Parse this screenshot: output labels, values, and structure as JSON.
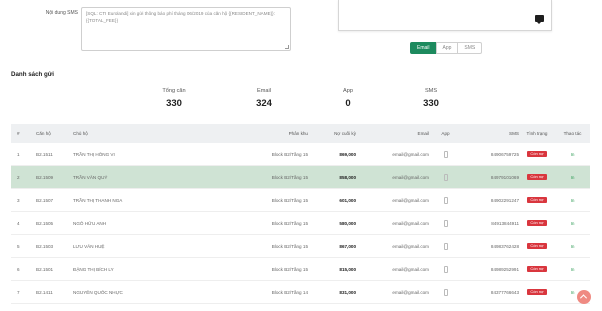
{
  "form": {
    "sms_label": "Nội dung SMS",
    "sms_content": "[SQL: CTI Eurolandi] xin gửi thông báo phí tháng 06/2019 của căn hộ {{RESIDENT_NAME}}: {{TOTAL_FEE}}"
  },
  "channels": [
    "Email",
    "App",
    "SMS"
  ],
  "active_channel": "Email",
  "section_title": "Danh sách gửi",
  "stats": [
    {
      "label": "Tổng căn",
      "value": "330"
    },
    {
      "label": "Email",
      "value": "324"
    },
    {
      "label": "App",
      "value": "0"
    },
    {
      "label": "SMS",
      "value": "330"
    }
  ],
  "table": {
    "headers": {
      "idx": "#",
      "unit": "Căn hộ",
      "owner": "Chủ hộ",
      "zone": "Phân khu",
      "last": "Nợ cuối kỳ",
      "email": "Email",
      "app": "App",
      "sms": "SMS",
      "status": "Tình trạng",
      "action": "Thao tác"
    },
    "rows": [
      {
        "idx": "1",
        "unit": "B2.1511",
        "owner": "TRẦN THỊ HỒNG VI",
        "zone": "Block B2/Tầng 15",
        "last": "869,000",
        "email": "email@gmail.com",
        "sms": "84906759725",
        "status": "Còn nợ",
        "action": "In"
      },
      {
        "idx": "2",
        "unit": "B2.1509",
        "owner": "TRẦN VĂN QUÝ",
        "zone": "Block B2/Tầng 15",
        "last": "858,000",
        "email": "email@gmail.com",
        "sms": "84979101069",
        "status": "Còn nợ",
        "action": "In"
      },
      {
        "idx": "3",
        "unit": "B2.1507",
        "owner": "TRẦN THỊ THANH NGA",
        "zone": "Block B2/Tầng 15",
        "last": "601,000",
        "email": "email@gmail.com",
        "sms": "84902291247",
        "status": "Còn nợ",
        "action": "In"
      },
      {
        "idx": "4",
        "unit": "B2.1505",
        "owner": "NGÔ HỮU ANH",
        "zone": "Block B2/Tầng 15",
        "last": "580,000",
        "email": "email@gmail.com",
        "sms": "84913844911",
        "status": "Còn nợ",
        "action": "In"
      },
      {
        "idx": "5",
        "unit": "B2.1503",
        "owner": "LƯU VĂN HUỆ",
        "zone": "Block B2/Tầng 15",
        "last": "867,000",
        "email": "email@gmail.com",
        "sms": "84983762428",
        "status": "Còn nợ",
        "action": "In"
      },
      {
        "idx": "6",
        "unit": "B2.1501",
        "owner": "ĐẶNG THỊ BÍCH LY",
        "zone": "Block B2/Tầng 15",
        "last": "815,000",
        "email": "email@gmail.com",
        "sms": "84989252991",
        "status": "Còn nợ",
        "action": "In"
      },
      {
        "idx": "7",
        "unit": "B2.1411",
        "owner": "NGUYỄN QUỐC NHỰC",
        "zone": "Block B2/Tầng 14",
        "last": "831,000",
        "email": "email@gmail.com",
        "sms": "84377766643",
        "status": "Còn nợ",
        "action": "In"
      }
    ],
    "highlighted_row": 1
  },
  "colors": {
    "accent": "#1d8a5e",
    "highlight_row": "#cfe3d4",
    "status_badge": "#d9363e",
    "fab": "#ef8a82"
  }
}
